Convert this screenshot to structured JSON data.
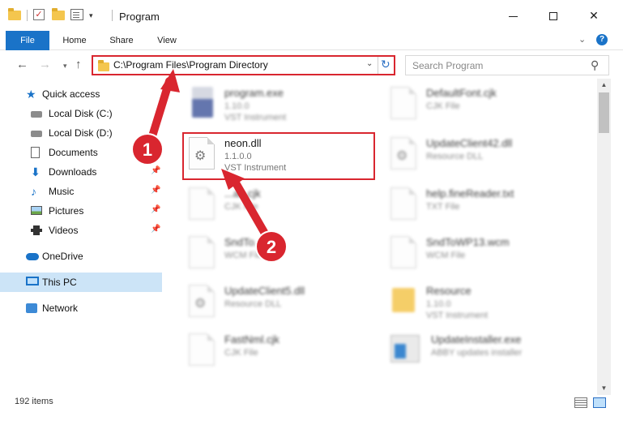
{
  "window": {
    "title": "Program",
    "minimize_glyph": "",
    "close_glyph": "✕"
  },
  "ribbon": {
    "tabs": [
      "File",
      "Home",
      "Share",
      "View"
    ],
    "help_label": "?"
  },
  "address_bar": {
    "path": "C:\\Program Files\\Program Directory"
  },
  "search": {
    "placeholder": "Search Program"
  },
  "sidebar": {
    "items": [
      {
        "label": "Quick access"
      },
      {
        "label": "Local Disk (C:)"
      },
      {
        "label": "Local Disk (D:)"
      },
      {
        "label": "Documents"
      },
      {
        "label": "Downloads"
      },
      {
        "label": "Music"
      },
      {
        "label": "Pictures"
      },
      {
        "label": "Videos"
      },
      {
        "label": "OneDrive"
      },
      {
        "label": "This PC"
      },
      {
        "label": "Network"
      }
    ],
    "selected": "This PC"
  },
  "files": {
    "left": [
      {
        "name": "program.exe",
        "line2": "1.10.0",
        "line3": "VST Instrument"
      },
      {
        "name": "neon.dll",
        "line2": "1.1.0.0",
        "line3": "VST Instrument"
      },
      {
        "name": "...an.cjk",
        "line2": "CJK File",
        "line3": ""
      },
      {
        "name": "SndTo...wcm",
        "line2": "WCM File",
        "line3": ""
      },
      {
        "name": "UpdateClient5.dll",
        "line2": "Resource DLL",
        "line3": ""
      },
      {
        "name": "FastNml.cjk",
        "line2": "CJK File",
        "line3": ""
      }
    ],
    "right": [
      {
        "name": "DefaultFont.cjk",
        "line2": "CJK File",
        "line3": ""
      },
      {
        "name": "UpdateClient42.dll",
        "line2": "Resource DLL",
        "line3": ""
      },
      {
        "name": "help.fineReader.txt",
        "line2": "TXT File",
        "line3": ""
      },
      {
        "name": "SndToWP13.wcm",
        "line2": "WCM File",
        "line3": ""
      },
      {
        "name": "Resource",
        "line2": "1.10.0",
        "line3": "VST Instrument"
      },
      {
        "name": "UpdateInstaller.exe",
        "line2": "ABBY updates installer",
        "line3": ""
      }
    ]
  },
  "status": {
    "item_count": "192 items"
  },
  "annotations": {
    "step1": "1",
    "step2": "2",
    "color": "#d9262f"
  }
}
